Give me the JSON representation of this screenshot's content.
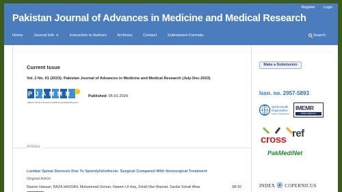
{
  "header": {
    "title": "Pakistan Journal of Advances in Medicine and Medical Research",
    "util_links": [
      "Register",
      "Login"
    ],
    "nav": [
      "Home",
      "Journal Info",
      "Instruction to Authors",
      "Archives",
      "Contact",
      "Submission Formats"
    ],
    "search_label": "Search"
  },
  "main": {
    "heading": "Current Issue",
    "issue": "Vol. 2 No. 01 (2023): Pakistan Journal of Advances in Medicine and Medical Research (July-Dec-2023)",
    "published_label": "Published:",
    "published_date": "05-01-2024",
    "logo_text": "PJAMMR",
    "logo_tagline": "Pakistan Journal of Advances in Medicine and Medical Research",
    "articles_heading": "Articles",
    "article": {
      "title": "Lumbar Spinal Stenosis Due To Spondylolisthesis- Surgical Compared With Nonsurgical Treatment",
      "type": "Original Article",
      "authors": "Naseer Hassan, RAZA HASSAN, Muhammad Usman, Naeem Ul Haq, Zahid Irfan Marwat, Sardar Sohail Afsar",
      "pages": "88-92"
    }
  },
  "sidebar": {
    "submit_label": "Make a Submission",
    "issn": "Issn. no. 2957-5893",
    "who_line1": "World Health",
    "who_line2": "Organization",
    "who_line3": "Eastern Mediterranean",
    "imemr_title": "IMEMR",
    "imemr_sub": "INDEX MEDICUS",
    "crossref_a": "cross",
    "crossref_b": "ref",
    "pakmedinet": "PakMediNet",
    "index_left": "INDEX",
    "index_right": "COPERNICUS"
  },
  "colors": {
    "header": "#4b7cbd",
    "link": "#2e6fb8",
    "frame": "#3a5a1e",
    "crossref_red": "#d2232a",
    "pakmedinet_green": "#1a8a2a"
  }
}
